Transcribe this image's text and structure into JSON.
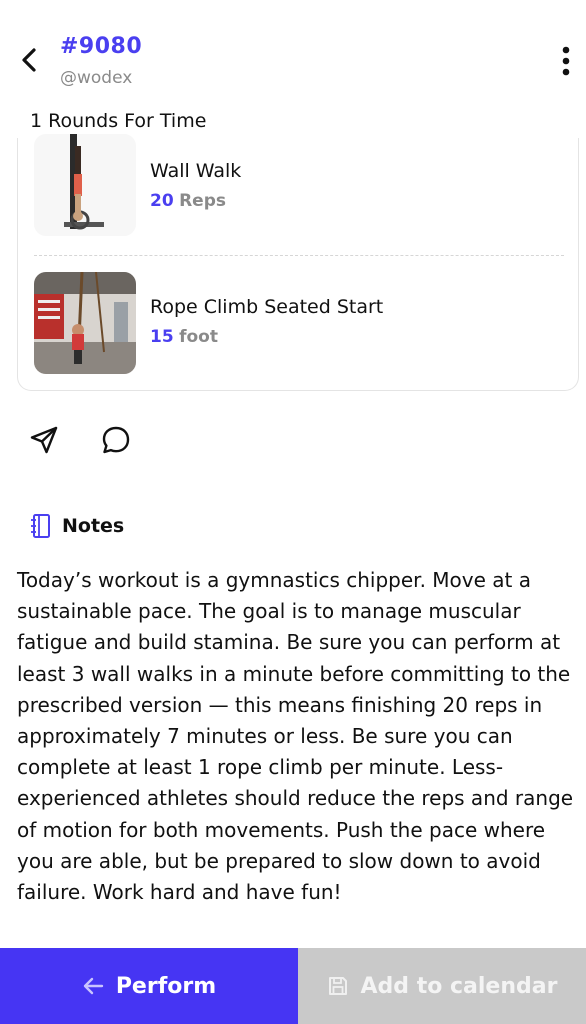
{
  "header": {
    "wod_id": "#9080",
    "author": "@wodex"
  },
  "workout": {
    "rounds_label": "1 Rounds For Time",
    "exercises": [
      {
        "name": "Wall Walk",
        "amount": "20",
        "unit": "Reps"
      },
      {
        "name": "Rope Climb Seated Start",
        "amount": "15",
        "unit": "foot"
      }
    ]
  },
  "notes": {
    "title": "Notes",
    "text": "Today’s workout is a gymnastics chipper. Move at a sustainable pace. The goal is to manage muscular fatigue and build stamina. Be sure you can perform at least 3 wall walks in a minute before committing to the prescribed version — this means finishing 20 reps in approximately 7 minutes or less. Be sure you can complete at least 1 rope climb per minute. Less-experienced athletes should reduce the reps and range of motion for both movements. Push the pace where you are able, but be prepared to slow down to avoid failure. Work hard and have fun!"
  },
  "bottom": {
    "perform_label": "Perform",
    "calendar_label": "Add to calendar"
  },
  "colors": {
    "accent": "#4635f3",
    "id_color": "#4a3ff0",
    "muted": "#8a8a8a",
    "disabled_button": "#c9c9c9"
  },
  "icons": {
    "back": "chevron-left-icon",
    "more": "more-vertical-icon",
    "share": "send-icon",
    "comment": "comment-bubble-icon",
    "notes": "notebook-icon",
    "perform": "arrow-left-icon",
    "calendar": "save-icon"
  }
}
